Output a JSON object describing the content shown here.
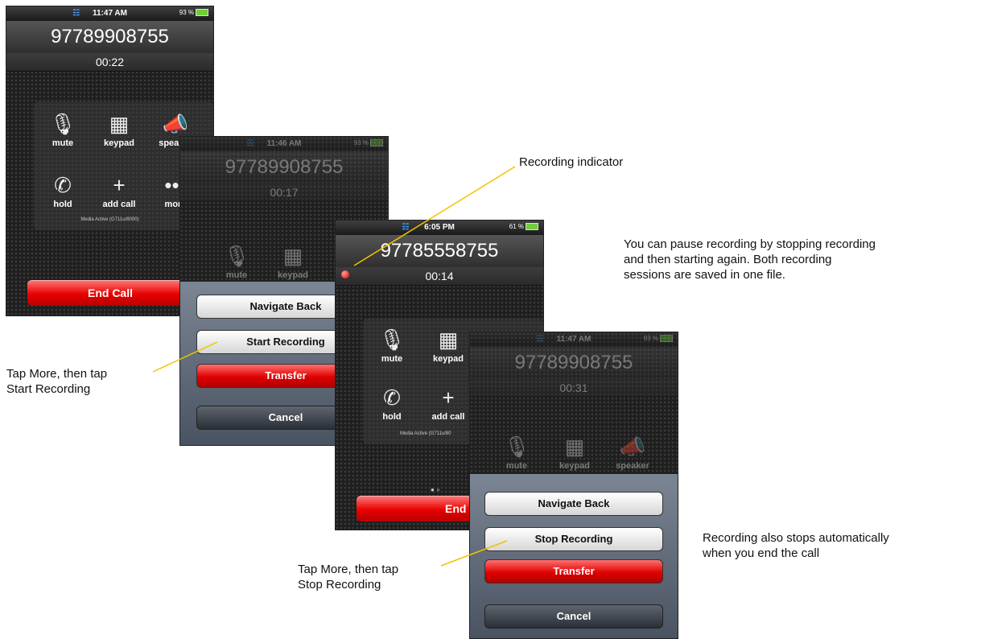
{
  "screen1": {
    "status": {
      "time": "11:47 AM",
      "battery": "93 %"
    },
    "number": "97789908755",
    "timer": "00:22",
    "keys": [
      {
        "label": "mute",
        "icon": "mic-muted-icon"
      },
      {
        "label": "keypad",
        "icon": "keypad-icon"
      },
      {
        "label": "speaker",
        "icon": "speaker-icon"
      },
      {
        "label": "hold",
        "icon": "hold-icon"
      },
      {
        "label": "add call",
        "icon": "add-call-icon"
      },
      {
        "label": "more",
        "icon": "more-icon"
      }
    ],
    "media_status": "Media Active (G711u/8000)",
    "end_call": "End Call"
  },
  "screen2": {
    "status": {
      "time": "11:46 AM",
      "battery": "93 %"
    },
    "number": "97789908755",
    "timer": "00:17",
    "keys": [
      {
        "label": "mute"
      },
      {
        "label": "keypad"
      }
    ],
    "actions": {
      "navigate_back": "Navigate Back",
      "start_recording": "Start Recording",
      "transfer": "Transfer",
      "cancel": "Cancel"
    }
  },
  "screen3": {
    "status": {
      "time": "6:05 PM",
      "battery": "61 %"
    },
    "number": "97785558755",
    "timer": "00:14",
    "keys": [
      {
        "label": "mute"
      },
      {
        "label": "keypad"
      },
      {
        "label": "hold"
      },
      {
        "label": "add call"
      }
    ],
    "media_status": "Media Active (G711u/80",
    "end_call": "End Call"
  },
  "screen4": {
    "status": {
      "time": "11:47 AM",
      "battery": "93 %"
    },
    "number": "97789908755",
    "timer": "00:31",
    "keys": [
      {
        "label": "mute"
      },
      {
        "label": "keypad"
      },
      {
        "label": "speaker"
      }
    ],
    "actions": {
      "navigate_back": "Navigate Back",
      "stop_recording": "Stop Recording",
      "transfer": "Transfer",
      "cancel": "Cancel"
    }
  },
  "callouts": {
    "recording_indicator": "Recording indicator",
    "pause_line1": "You can pause recording by stopping recording",
    "pause_line2": "and then starting again. Both recording",
    "pause_line3": "sessions are saved in one file.",
    "start_line1": "Tap More, then tap",
    "start_line2": "Start Recording",
    "stop_line1": "Tap More, then tap",
    "stop_line2": "Stop Recording",
    "auto_line1": "Recording also stops automatically",
    "auto_line2": "when you end the call"
  },
  "colors": {
    "end_call_red": "#e80000",
    "wifi_blue": "#4aa0ff",
    "leader_line": "#f2c200",
    "recording_dot": "#e00000"
  }
}
